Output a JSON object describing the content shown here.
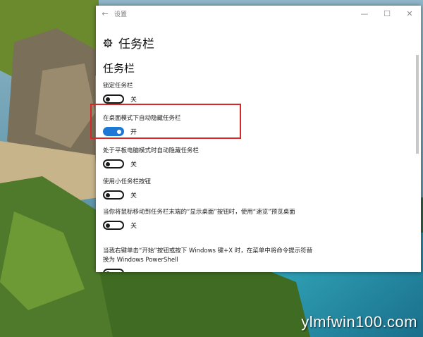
{
  "window": {
    "title": "设置",
    "back_icon": "back-arrow-icon",
    "controls": [
      "—",
      "☐",
      "✕"
    ]
  },
  "page": {
    "icon": "gear-icon",
    "title": "任务栏",
    "section": "任务栏"
  },
  "settings": [
    {
      "label": "锁定任务栏",
      "state": "关",
      "on": false
    },
    {
      "label": "在桌面模式下自动隐藏任务栏",
      "state": "开",
      "on": true
    },
    {
      "label": "处于平板电脑模式时自动隐藏任务栏",
      "state": "关",
      "on": false
    },
    {
      "label": "使用小任务栏按钮",
      "state": "关",
      "on": false
    },
    {
      "label": "当你将鼠标移动到任务栏末端的“显示桌面”按钮时，使用“速览”预览桌面",
      "state": "关",
      "on": false
    },
    {
      "label": "当我右键单击“开始”按钮或按下 Windows 键+X 时，在菜单中将命令提示符替换为 Windows PowerShell",
      "state": "",
      "on": false
    }
  ],
  "colors": {
    "accent": "#1c78d4",
    "highlight_box": "#d62828"
  },
  "watermark": "ylmfwin100.com"
}
